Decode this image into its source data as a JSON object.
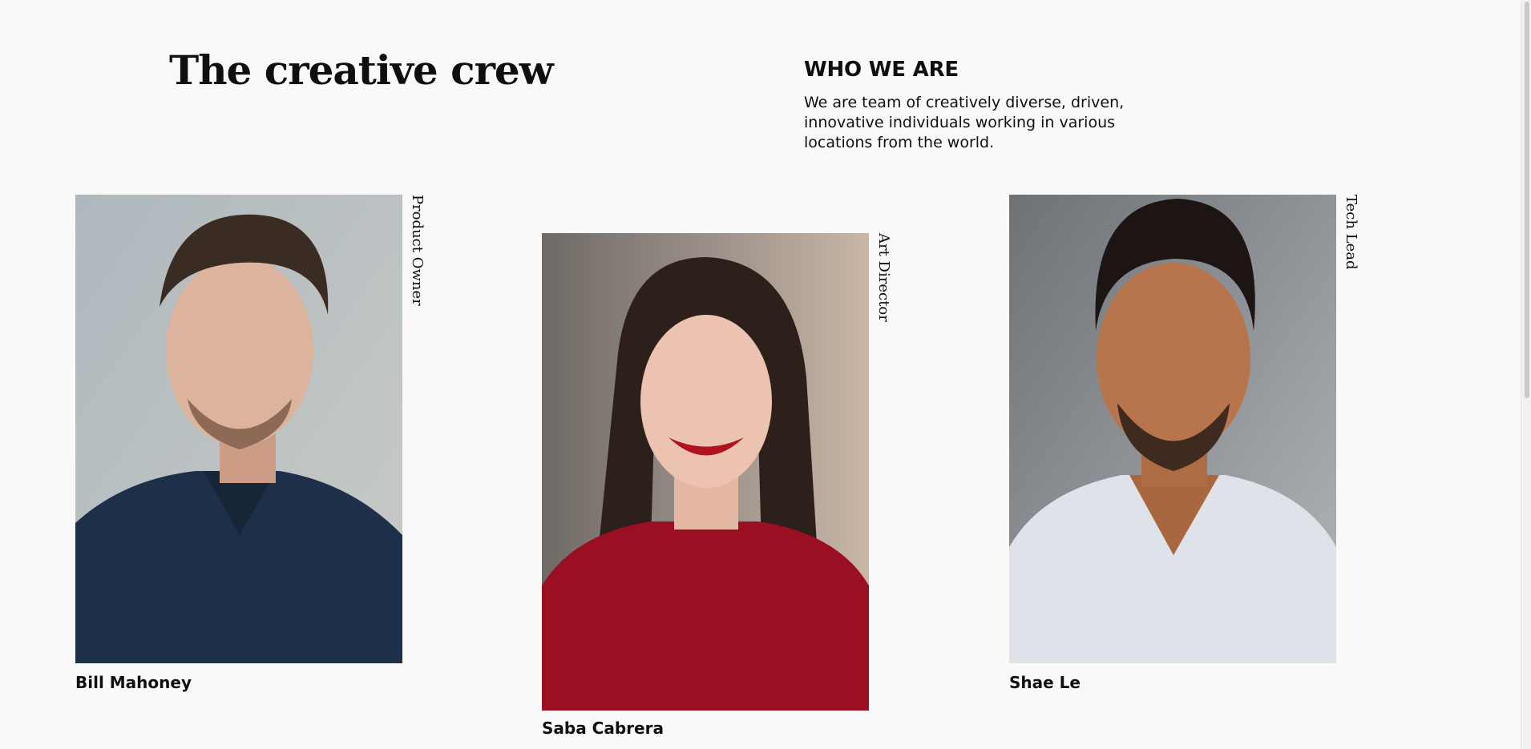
{
  "header": {
    "title": "The creative crew"
  },
  "about": {
    "heading": "WHO WE ARE",
    "text": "We are team of creatively diverse, driven, innovative individuals working in various locations from the world."
  },
  "team": [
    {
      "name": "Bill Mahoney",
      "role": "Product Owner"
    },
    {
      "name": "Saba Cabrera",
      "role": "Art Director"
    },
    {
      "name": "Shae Le",
      "role": "Tech Lead"
    }
  ],
  "colors": {
    "background": "#f9f9f9",
    "text": "#0f0f0f"
  }
}
